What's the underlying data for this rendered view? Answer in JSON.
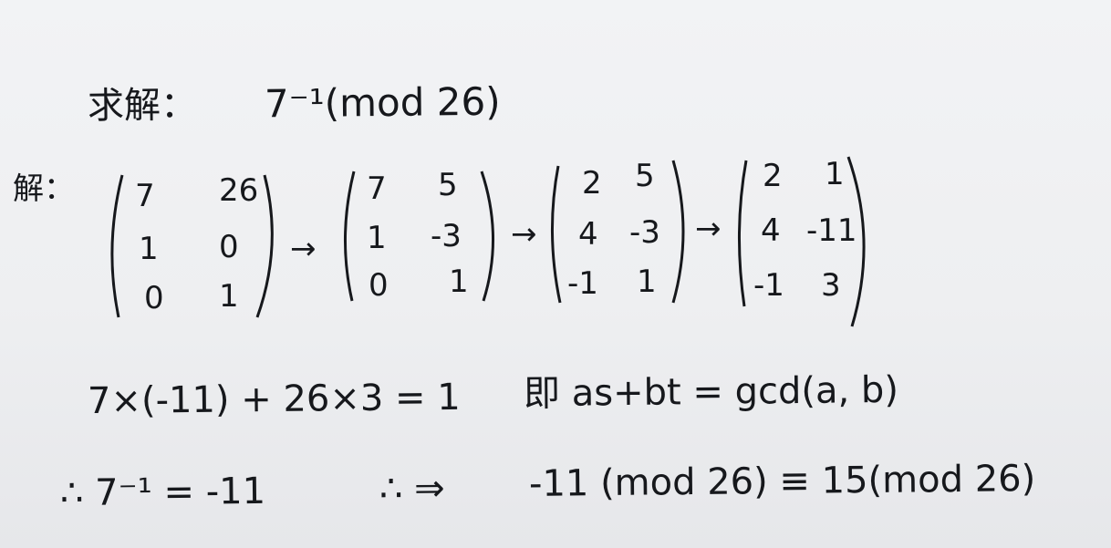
{
  "problem": {
    "label": "求解：",
    "expr": "7⁻¹(mod 26)"
  },
  "solution": {
    "label": "解：",
    "arrow": "→",
    "matrices": [
      {
        "rows": [
          [
            "7",
            "26"
          ],
          [
            "1",
            "0"
          ],
          [
            "0",
            "1"
          ]
        ]
      },
      {
        "rows": [
          [
            "7",
            "5"
          ],
          [
            "1",
            "-3"
          ],
          [
            "0",
            "1"
          ]
        ]
      },
      {
        "rows": [
          [
            "2",
            "5"
          ],
          [
            "4",
            "-3"
          ],
          [
            "-1",
            "1"
          ]
        ]
      },
      {
        "rows": [
          [
            "2",
            "1"
          ],
          [
            "4",
            "-11"
          ],
          [
            "-1",
            "3"
          ]
        ]
      }
    ]
  },
  "equation": {
    "lhs": "7×(-11) + 26×3 = 1",
    "note": "即 as+bt = gcd(a, b)"
  },
  "conclusion": {
    "inverse": "∴ 7⁻¹ = -11",
    "implies": "∴ ⇒",
    "result": "-11 (mod 26) ≡ 15(mod 26)"
  }
}
